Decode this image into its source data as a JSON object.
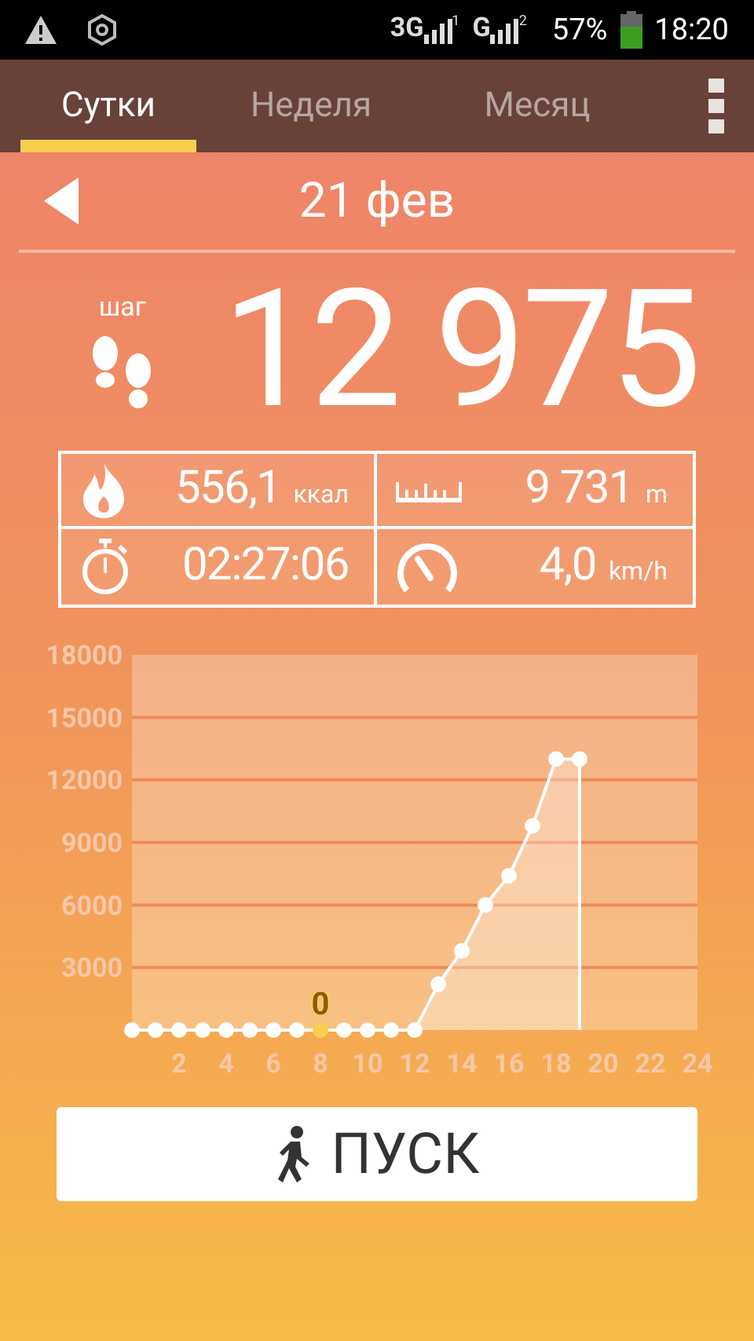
{
  "status_bar": {
    "networks": [
      {
        "label": "3G",
        "sim": "1"
      },
      {
        "label": "G",
        "sim": "2"
      }
    ],
    "battery": "57%",
    "time": "18:20"
  },
  "tabs": [
    {
      "label": "Сутки",
      "selected": true
    },
    {
      "label": "Неделя",
      "selected": false
    },
    {
      "label": "Месяц",
      "selected": false
    }
  ],
  "date": "21 фев",
  "steps": {
    "unit": "шаг",
    "value": "12 975"
  },
  "stats": [
    {
      "kind": "calories",
      "value": "556,1",
      "unit": "ккал"
    },
    {
      "kind": "distance",
      "value": "9 731",
      "unit": "m"
    },
    {
      "kind": "time",
      "value": "02:27:06"
    },
    {
      "kind": "speed",
      "value": "4,0",
      "unit": "km/h"
    }
  ],
  "chart_data": {
    "type": "area",
    "x": [
      0,
      1,
      2,
      3,
      4,
      5,
      6,
      7,
      8,
      9,
      10,
      11,
      12,
      13,
      14,
      15,
      16,
      17,
      18,
      19
    ],
    "grid": true,
    "series": [
      {
        "color": "#ffffff",
        "values": [
          0,
          0,
          0,
          0,
          0,
          0,
          0,
          0,
          0,
          0,
          0,
          0,
          0,
          2200,
          3800,
          6000,
          7400,
          9800,
          13000,
          13000
        ]
      }
    ],
    "xlim": [
      0,
      24
    ],
    "ylim": [
      0,
      18000
    ],
    "xticks": [
      2,
      4,
      6,
      8,
      10,
      12,
      14,
      16,
      18,
      20,
      22,
      24
    ],
    "yticks": [
      3000,
      6000,
      9000,
      12000,
      15000,
      18000
    ],
    "annotations": [
      {
        "x": 8,
        "y": 0,
        "text": "0"
      }
    ]
  },
  "start_button": "ПУСК"
}
